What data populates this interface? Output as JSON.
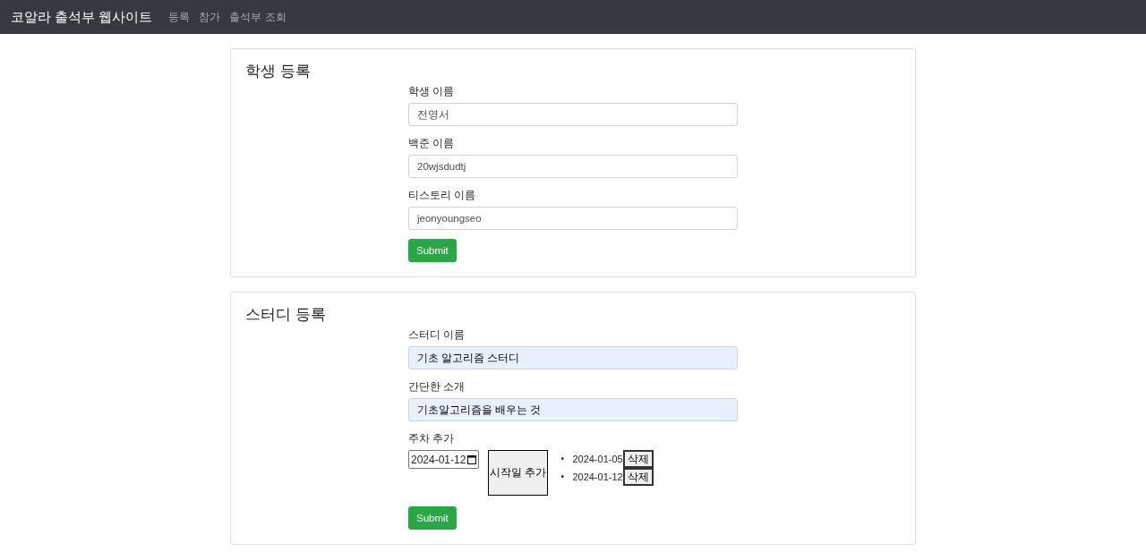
{
  "navbar": {
    "brand": "코알라 출석부 웹사이트",
    "links": [
      {
        "label": "등록"
      },
      {
        "label": "참가"
      },
      {
        "label": "출석부 조회"
      }
    ]
  },
  "cards": [
    {
      "title": "학생 등록",
      "fields": [
        {
          "label": "학생 이름",
          "value": "전영서",
          "autofilled": false
        },
        {
          "label": "백준 이름",
          "value": "20wjsdudtj",
          "autofilled": false
        },
        {
          "label": "티스토리 이름",
          "value": "jeonyoungseo",
          "autofilled": false
        }
      ],
      "submit": "Submit"
    },
    {
      "title": "스터디 등록",
      "fields": [
        {
          "label": "스터디 이름",
          "value": "기초 알고리즘 스터디",
          "autofilled": true
        },
        {
          "label": "간단한 소개",
          "value": "기초알고리즘을 배우는 것",
          "autofilled": true
        }
      ],
      "weeks": {
        "label": "주차 추가",
        "date": "2024-01-12",
        "add_button": "시작일 추가",
        "items": [
          {
            "marker": "•",
            "date": "2024-01-05",
            "delete": "삭제"
          },
          {
            "marker": "•",
            "date": "2024-01-12",
            "delete": "삭제"
          }
        ]
      },
      "submit": "Submit"
    }
  ]
}
